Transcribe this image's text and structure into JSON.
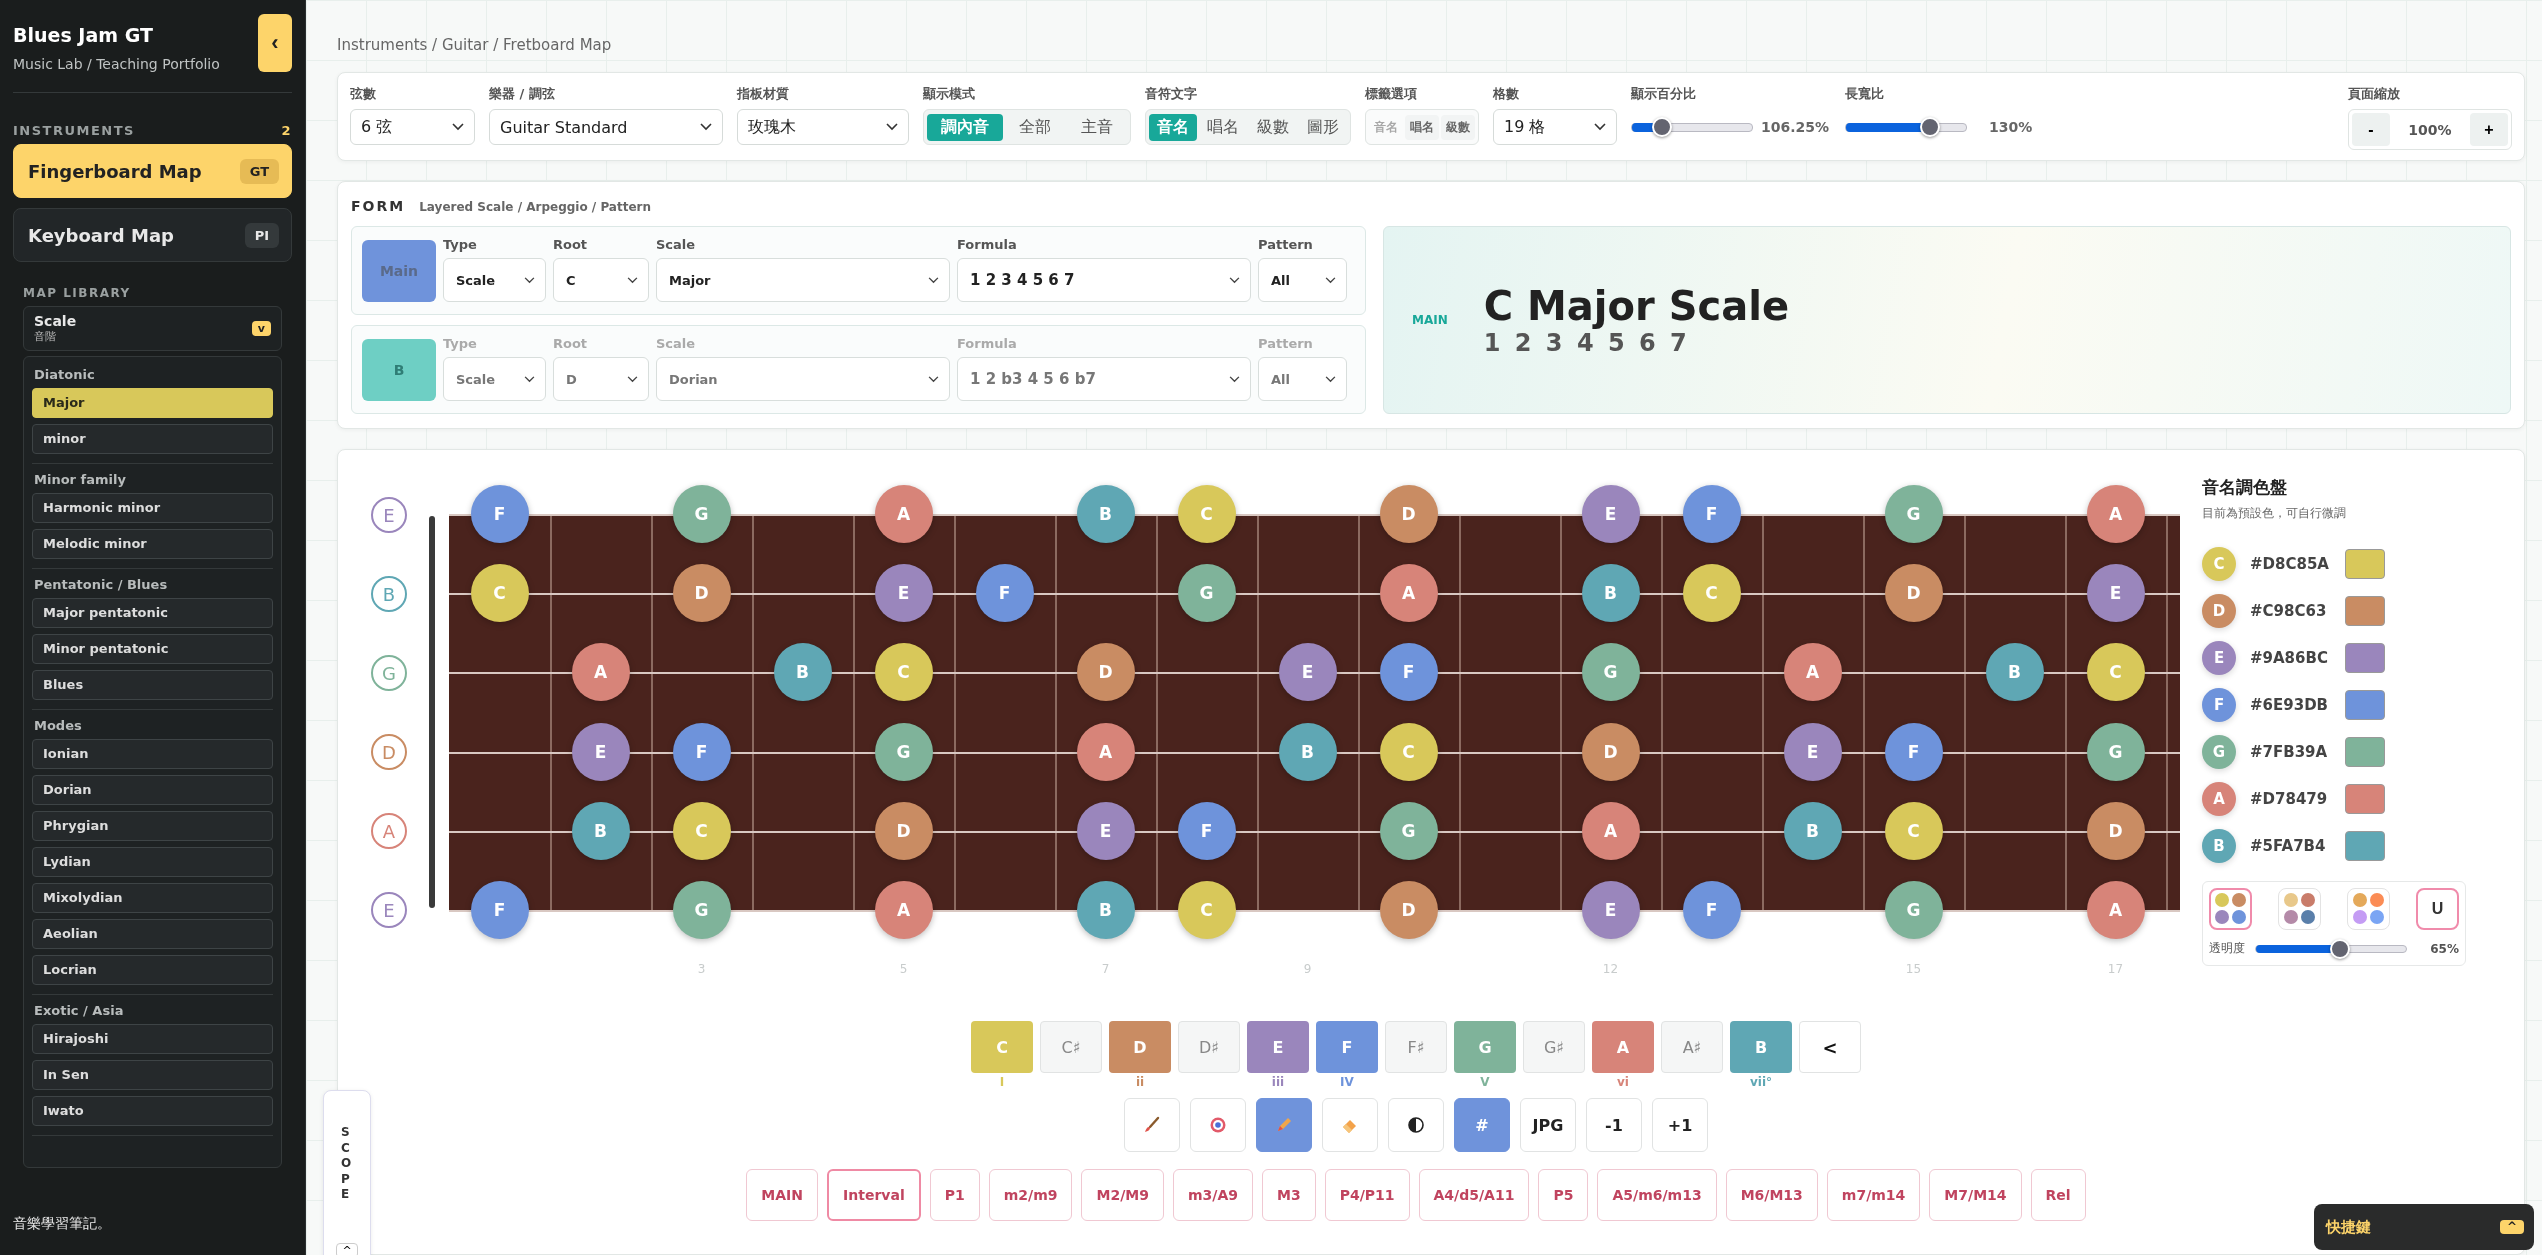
{
  "sidebar": {
    "title": "Blues Jam GT",
    "subtitle": "Music Lab / Teaching Portfolio",
    "collapse_button": "‹",
    "section_label": "INSTRUMENTS",
    "section_count": "2",
    "instruments": [
      {
        "name": "Fingerboard Map",
        "badge": "GT",
        "selected": true
      },
      {
        "name": "Keyboard Map",
        "badge": "PI",
        "selected": false
      }
    ],
    "library_label": "MAP LIBRARY",
    "library_dropdown": {
      "value": "Scale",
      "sub": "音階",
      "button": "v"
    },
    "groups": [
      {
        "title": "Diatonic",
        "items": [
          {
            "label": "Major",
            "selected": true
          },
          {
            "label": "minor",
            "selected": false
          }
        ]
      },
      {
        "title": "Minor family",
        "items": [
          {
            "label": "Harmonic minor",
            "selected": false
          },
          {
            "label": "Melodic minor",
            "selected": false
          }
        ]
      },
      {
        "title": "Pentatonic / Blues",
        "items": [
          {
            "label": "Major pentatonic",
            "selected": false
          },
          {
            "label": "Minor pentatonic",
            "selected": false
          },
          {
            "label": "Blues",
            "selected": false
          }
        ]
      },
      {
        "title": "Modes",
        "items": [
          {
            "label": "Ionian",
            "selected": false
          },
          {
            "label": "Dorian",
            "selected": false
          },
          {
            "label": "Phrygian",
            "selected": false
          },
          {
            "label": "Lydian",
            "selected": false
          },
          {
            "label": "Mixolydian",
            "selected": false
          },
          {
            "label": "Aeolian",
            "selected": false
          },
          {
            "label": "Locrian",
            "selected": false
          }
        ]
      },
      {
        "title": "Exotic / Asia",
        "items": [
          {
            "label": "Hirajoshi",
            "selected": false
          },
          {
            "label": "In Sen",
            "selected": false
          },
          {
            "label": "Iwato",
            "selected": false
          }
        ]
      }
    ],
    "footer": "音樂學習筆記。"
  },
  "breadcrumb": "Instruments / Guitar / Fretboard Map",
  "toolbar": {
    "controls": [
      {
        "kind": "select",
        "label": "弦數",
        "value": "6 弦"
      },
      {
        "kind": "select",
        "label": "樂器 / 調弦",
        "value": "Guitar Standard"
      },
      {
        "kind": "select",
        "label": "指板材質",
        "value": "玫瑰木"
      },
      {
        "kind": "segmented",
        "label": "顯示模式",
        "options": [
          {
            "label": "調內音",
            "selected": true
          },
          {
            "label": "全部",
            "selected": false
          },
          {
            "label": "主音",
            "selected": false
          }
        ]
      },
      {
        "kind": "segmented",
        "label": "音符文字",
        "options": [
          {
            "label": "音名",
            "selected": true
          },
          {
            "label": "唱名",
            "selected": false
          },
          {
            "label": "級數",
            "selected": false
          },
          {
            "label": "圖形",
            "selected": false
          }
        ]
      },
      {
        "kind": "toggles",
        "label": "標籤選項",
        "options": [
          {
            "label": "音名",
            "disabled": true
          },
          {
            "label": "唱名",
            "disabled": false
          },
          {
            "label": "級數",
            "disabled": false
          }
        ]
      },
      {
        "kind": "select",
        "label": "格數",
        "value": "19 格"
      },
      {
        "kind": "slider",
        "label": "顯示百分比",
        "level": 0.25,
        "reading": "106.25%"
      },
      {
        "kind": "slider",
        "label": "長寬比",
        "level": 0.7,
        "reading": "130%"
      }
    ],
    "zoom": {
      "label": "頁面縮放",
      "minus": "-",
      "value": "100%",
      "plus": "+"
    }
  },
  "form": {
    "title": "FORM",
    "subtitle": "Layered Scale / Arpeggio / Pattern",
    "layers": [
      {
        "name": "Main",
        "color": "#6f93db",
        "active": true,
        "fields": [
          {
            "label": "Type",
            "value": "Scale"
          },
          {
            "label": "Root",
            "value": "C"
          },
          {
            "label": "Scale",
            "value": "Major"
          },
          {
            "label": "Formula",
            "value": "1 2 3 4 5 6 7"
          },
          {
            "label": "Pattern",
            "value": "All"
          }
        ]
      },
      {
        "name": "B",
        "color": "#6ecfc4",
        "active": false,
        "fields": [
          {
            "label": "Type",
            "value": "Scale"
          },
          {
            "label": "Root",
            "value": "D"
          },
          {
            "label": "Scale",
            "value": "Dorian"
          },
          {
            "label": "Formula",
            "value": "1 2 b3 4 5 6 b7"
          },
          {
            "label": "Pattern",
            "value": "All"
          }
        ]
      }
    ],
    "display": {
      "tag": "MAIN",
      "title": "C Major Scale",
      "formula": "1 2 3 4 5 6 7"
    }
  },
  "fretboard": {
    "strings": [
      {
        "open": "E",
        "color": "#9a86bc",
        "frets": [
          {
            "kind": "note",
            "note": "F",
            "color": "#6e93db"
          },
          {
            "kind": "empty"
          },
          {
            "kind": "note",
            "note": "G",
            "color": "#7fb39a"
          },
          {
            "kind": "empty"
          },
          {
            "kind": "note",
            "note": "A",
            "color": "#d78479"
          },
          {
            "kind": "empty"
          },
          {
            "kind": "note",
            "note": "B",
            "color": "#5fa7b4"
          },
          {
            "kind": "note",
            "note": "C",
            "color": "#d8c85a"
          },
          {
            "kind": "empty"
          },
          {
            "kind": "note",
            "note": "D",
            "color": "#c98c63"
          },
          {
            "kind": "empty"
          },
          {
            "kind": "note",
            "note": "E",
            "color": "#9a86bc"
          },
          {
            "kind": "note",
            "note": "F",
            "color": "#6e93db"
          },
          {
            "kind": "empty"
          },
          {
            "kind": "note",
            "note": "G",
            "color": "#7fb39a"
          },
          {
            "kind": "empty"
          },
          {
            "kind": "note",
            "note": "A",
            "color": "#d78479"
          }
        ]
      },
      {
        "open": "B",
        "color": "#5fa7b4",
        "frets": [
          {
            "kind": "note",
            "note": "C",
            "color": "#d8c85a"
          },
          {
            "kind": "empty"
          },
          {
            "kind": "note",
            "note": "D",
            "color": "#c98c63"
          },
          {
            "kind": "empty"
          },
          {
            "kind": "note",
            "note": "E",
            "color": "#9a86bc"
          },
          {
            "kind": "note",
            "note": "F",
            "color": "#6e93db"
          },
          {
            "kind": "empty"
          },
          {
            "kind": "note",
            "note": "G",
            "color": "#7fb39a"
          },
          {
            "kind": "empty"
          },
          {
            "kind": "note",
            "note": "A",
            "color": "#d78479"
          },
          {
            "kind": "empty"
          },
          {
            "kind": "note",
            "note": "B",
            "color": "#5fa7b4"
          },
          {
            "kind": "note",
            "note": "C",
            "color": "#d8c85a"
          },
          {
            "kind": "empty"
          },
          {
            "kind": "note",
            "note": "D",
            "color": "#c98c63"
          },
          {
            "kind": "empty"
          },
          {
            "kind": "note",
            "note": "E",
            "color": "#9a86bc"
          }
        ]
      },
      {
        "open": "G",
        "color": "#7fb39a",
        "frets": [
          {
            "kind": "empty"
          },
          {
            "kind": "note",
            "note": "A",
            "color": "#d78479"
          },
          {
            "kind": "empty"
          },
          {
            "kind": "note",
            "note": "B",
            "color": "#5fa7b4"
          },
          {
            "kind": "note",
            "note": "C",
            "color": "#d8c85a"
          },
          {
            "kind": "empty"
          },
          {
            "kind": "note",
            "note": "D",
            "color": "#c98c63"
          },
          {
            "kind": "empty"
          },
          {
            "kind": "note",
            "note": "E",
            "color": "#9a86bc"
          },
          {
            "kind": "note",
            "note": "F",
            "color": "#6e93db"
          },
          {
            "kind": "empty"
          },
          {
            "kind": "note",
            "note": "G",
            "color": "#7fb39a"
          },
          {
            "kind": "empty"
          },
          {
            "kind": "note",
            "note": "A",
            "color": "#d78479"
          },
          {
            "kind": "empty"
          },
          {
            "kind": "note",
            "note": "B",
            "color": "#5fa7b4"
          },
          {
            "kind": "note",
            "note": "C",
            "color": "#d8c85a"
          }
        ]
      },
      {
        "open": "D",
        "color": "#c98c63",
        "frets": [
          {
            "kind": "empty"
          },
          {
            "kind": "note",
            "note": "E",
            "color": "#9a86bc"
          },
          {
            "kind": "note",
            "note": "F",
            "color": "#6e93db"
          },
          {
            "kind": "empty"
          },
          {
            "kind": "note",
            "note": "G",
            "color": "#7fb39a"
          },
          {
            "kind": "empty"
          },
          {
            "kind": "note",
            "note": "A",
            "color": "#d78479"
          },
          {
            "kind": "empty"
          },
          {
            "kind": "note",
            "note": "B",
            "color": "#5fa7b4"
          },
          {
            "kind": "note",
            "note": "C",
            "color": "#d8c85a"
          },
          {
            "kind": "empty"
          },
          {
            "kind": "note",
            "note": "D",
            "color": "#c98c63"
          },
          {
            "kind": "empty"
          },
          {
            "kind": "note",
            "note": "E",
            "color": "#9a86bc"
          },
          {
            "kind": "note",
            "note": "F",
            "color": "#6e93db"
          },
          {
            "kind": "empty"
          },
          {
            "kind": "note",
            "note": "G",
            "color": "#7fb39a"
          }
        ]
      },
      {
        "open": "A",
        "color": "#d78479",
        "frets": [
          {
            "kind": "empty"
          },
          {
            "kind": "note",
            "note": "B",
            "color": "#5fa7b4"
          },
          {
            "kind": "note",
            "note": "C",
            "color": "#d8c85a"
          },
          {
            "kind": "empty"
          },
          {
            "kind": "note",
            "note": "D",
            "color": "#c98c63"
          },
          {
            "kind": "empty"
          },
          {
            "kind": "note",
            "note": "E",
            "color": "#9a86bc"
          },
          {
            "kind": "note",
            "note": "F",
            "color": "#6e93db"
          },
          {
            "kind": "empty"
          },
          {
            "kind": "note",
            "note": "G",
            "color": "#7fb39a"
          },
          {
            "kind": "empty"
          },
          {
            "kind": "note",
            "note": "A",
            "color": "#d78479"
          },
          {
            "kind": "empty"
          },
          {
            "kind": "note",
            "note": "B",
            "color": "#5fa7b4"
          },
          {
            "kind": "note",
            "note": "C",
            "color": "#d8c85a"
          },
          {
            "kind": "empty"
          },
          {
            "kind": "note",
            "note": "D",
            "color": "#c98c63"
          }
        ]
      },
      {
        "open": "E",
        "color": "#9a86bc",
        "frets": [
          {
            "kind": "note",
            "note": "F",
            "color": "#6e93db"
          },
          {
            "kind": "empty"
          },
          {
            "kind": "note",
            "note": "G",
            "color": "#7fb39a"
          },
          {
            "kind": "empty"
          },
          {
            "kind": "note",
            "note": "A",
            "color": "#d78479"
          },
          {
            "kind": "empty"
          },
          {
            "kind": "note",
            "note": "B",
            "color": "#5fa7b4"
          },
          {
            "kind": "note",
            "note": "C",
            "color": "#d8c85a"
          },
          {
            "kind": "empty"
          },
          {
            "kind": "note",
            "note": "D",
            "color": "#c98c63"
          },
          {
            "kind": "empty"
          },
          {
            "kind": "note",
            "note": "E",
            "color": "#9a86bc"
          },
          {
            "kind": "note",
            "note": "F",
            "color": "#6e93db"
          },
          {
            "kind": "empty"
          },
          {
            "kind": "note",
            "note": "G",
            "color": "#7fb39a"
          },
          {
            "kind": "empty"
          },
          {
            "kind": "note",
            "note": "A",
            "color": "#d78479"
          }
        ]
      }
    ],
    "fret_labels": [
      {
        "kind": "empty"
      },
      {
        "kind": "empty"
      },
      {
        "kind": "label",
        "text": "3"
      },
      {
        "kind": "empty"
      },
      {
        "kind": "label",
        "text": "5"
      },
      {
        "kind": "empty"
      },
      {
        "kind": "label",
        "text": "7"
      },
      {
        "kind": "empty"
      },
      {
        "kind": "label",
        "text": "9"
      },
      {
        "kind": "empty"
      },
      {
        "kind": "empty"
      },
      {
        "kind": "label",
        "text": "12"
      },
      {
        "kind": "empty"
      },
      {
        "kind": "empty"
      },
      {
        "kind": "label",
        "text": "15"
      },
      {
        "kind": "empty"
      },
      {
        "kind": "label",
        "text": "17"
      }
    ]
  },
  "palette": {
    "title": "音名調色盤",
    "subtitle": "目前為預設色，可自行微調",
    "notes": [
      {
        "note": "C",
        "hex": "#D8C85A",
        "color": "#d8c85a"
      },
      {
        "note": "D",
        "hex": "#C98C63",
        "color": "#c98c63"
      },
      {
        "note": "E",
        "hex": "#9A86BC",
        "color": "#9a86bc"
      },
      {
        "note": "F",
        "hex": "#6E93DB",
        "color": "#6e93db"
      },
      {
        "note": "G",
        "hex": "#7FB39A",
        "color": "#7fb39a"
      },
      {
        "note": "A",
        "hex": "#D78479",
        "color": "#d78479"
      },
      {
        "note": "B",
        "hex": "#5FA7B4",
        "color": "#5fa7b4"
      }
    ],
    "presets": [
      {
        "kind": "dots",
        "selected": true,
        "dots": [
          {
            "color": "#d8c85a"
          },
          {
            "color": "#c98c63"
          },
          {
            "color": "#9a86bc"
          },
          {
            "color": "#6e93db"
          }
        ]
      },
      {
        "kind": "dots",
        "selected": false,
        "dots": [
          {
            "color": "#e8c88a"
          },
          {
            "color": "#c97c6a"
          },
          {
            "color": "#b48aa8"
          },
          {
            "color": "#5a7faa"
          }
        ]
      },
      {
        "kind": "dots",
        "selected": false,
        "dots": [
          {
            "color": "#e4a95a"
          },
          {
            "color": "#fb8c55"
          },
          {
            "color": "#c49cf4"
          },
          {
            "color": "#7aa5f4"
          }
        ]
      },
      {
        "kind": "text",
        "selected": true,
        "label": "U"
      }
    ],
    "opacity": {
      "label": "透明度",
      "level": 0.56,
      "reading": "65%"
    }
  },
  "chips": [
    {
      "label": "C",
      "in_scale": true,
      "color": "#d8c85a",
      "degree": "I"
    },
    {
      "label": "C♯",
      "in_scale": false
    },
    {
      "label": "D",
      "in_scale": true,
      "color": "#c98c63",
      "degree": "ii"
    },
    {
      "label": "D♯",
      "in_scale": false
    },
    {
      "label": "E",
      "in_scale": true,
      "color": "#9a86bc",
      "degree": "iii"
    },
    {
      "label": "F",
      "in_scale": true,
      "color": "#6e93db",
      "degree": "IV"
    },
    {
      "label": "F♯",
      "in_scale": false
    },
    {
      "label": "G",
      "in_scale": true,
      "color": "#7fb39a",
      "degree": "V"
    },
    {
      "label": "G♯",
      "in_scale": false
    },
    {
      "label": "A",
      "in_scale": true,
      "color": "#d78479",
      "degree": "vi"
    },
    {
      "label": "A♯",
      "in_scale": false
    },
    {
      "label": "B",
      "in_scale": true,
      "color": "#5fa7b4",
      "degree": "vii°"
    }
  ],
  "chips_back": "<",
  "tools": [
    {
      "kind": "brush",
      "selected": false
    },
    {
      "kind": "target",
      "selected": false
    },
    {
      "kind": "pencil",
      "selected": true
    },
    {
      "kind": "eraser",
      "selected": false
    },
    {
      "kind": "contrast",
      "selected": false
    },
    {
      "kind": "text",
      "label": "#",
      "selected": true
    },
    {
      "kind": "text",
      "label": "JPG",
      "selected": false
    },
    {
      "kind": "text",
      "label": "-1",
      "selected": false
    },
    {
      "kind": "text",
      "label": "+1",
      "selected": false
    }
  ],
  "intervals": [
    {
      "label": "MAIN",
      "selected": false
    },
    {
      "label": "Interval",
      "selected": true
    },
    {
      "label": "P1",
      "selected": false
    },
    {
      "label": "m2/m9",
      "selected": false
    },
    {
      "label": "M2/M9",
      "selected": false
    },
    {
      "label": "m3/A9",
      "selected": false
    },
    {
      "label": "M3",
      "selected": false
    },
    {
      "label": "P4/P11",
      "selected": false
    },
    {
      "label": "A4/d5/A11",
      "selected": false
    },
    {
      "label": "P5",
      "selected": false
    },
    {
      "label": "A5/m6/m13",
      "selected": false
    },
    {
      "label": "M6/M13",
      "selected": false
    },
    {
      "label": "m7/m14",
      "selected": false
    },
    {
      "label": "M7/M14",
      "selected": false
    },
    {
      "label": "Rel",
      "selected": false
    }
  ],
  "scope": {
    "label": "SCOPE",
    "button": "^"
  },
  "shortcuts": {
    "label": "快捷鍵",
    "button": "^"
  }
}
